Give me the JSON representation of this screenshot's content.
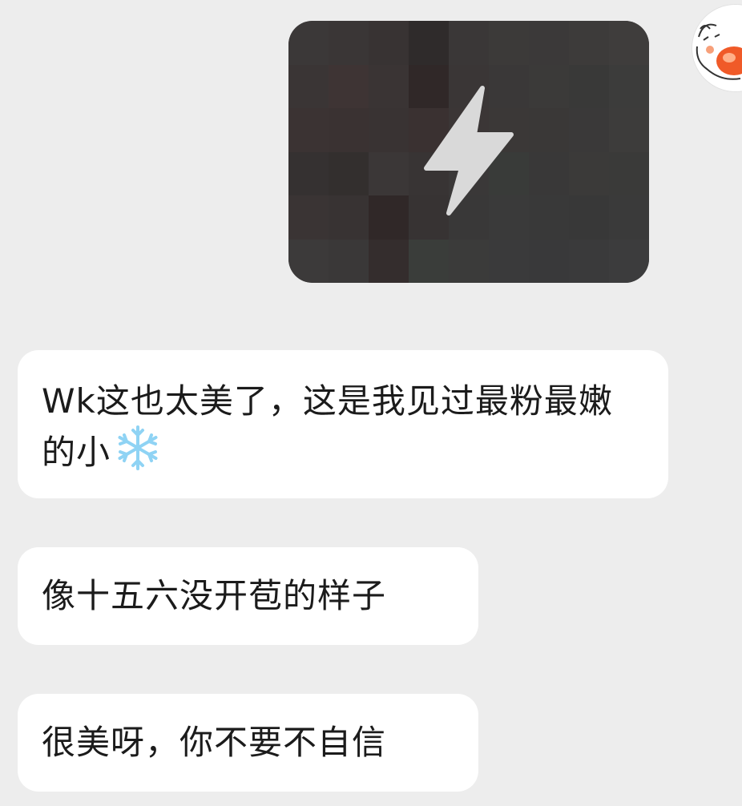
{
  "chat": {
    "messages": [
      {
        "side": "right",
        "type": "media",
        "thumbnail": "pixelated-dark-image",
        "overlay_icon": "flash-icon",
        "mosaic_colors": [
          "#3b3838",
          "#3a3636",
          "#383333",
          "#2f2b2b",
          "#3a3737",
          "#3c3a39",
          "#3b3939",
          "#3d3b3a",
          "#3f3d3c",
          "#3a3535",
          "#3e3434",
          "#3a3434",
          "#302828",
          "#3a3636",
          "#3a3838",
          "#3b3a39",
          "#393938",
          "#3c3c3b",
          "#3b3333",
          "#3a3232",
          "#393333",
          "#3a3131",
          "#3b3636",
          "#3b3837",
          "#3a3837",
          "#3a3939",
          "#3d3c3b",
          "#353131",
          "#332f2e",
          "#3b3737",
          "#383434",
          "#3a3838",
          "#393b39",
          "#393838",
          "#3b3a39",
          "#3a3a39",
          "#3a3434",
          "#383333",
          "#302828",
          "#373333",
          "#393838",
          "#3a3a3a",
          "#393939",
          "#383838",
          "#3a3a3a",
          "#3c3a3a",
          "#3a3838",
          "#342d2d",
          "#3a3d3a",
          "#3b3b3a",
          "#3a3a3b",
          "#39393a",
          "#3a3a3b",
          "#3c3c3d"
        ]
      },
      {
        "side": "left",
        "type": "text",
        "text": "Wk这也太美了，这是我见过最粉最嫩的小",
        "trailing_icon": "snowflake-icon"
      },
      {
        "side": "left",
        "type": "text",
        "text": "像十五六没开苞的样子"
      },
      {
        "side": "left",
        "type": "text",
        "text": "很美呀，你不要不自信"
      }
    ]
  },
  "colors": {
    "background": "#ededed",
    "bubble": "#ffffff",
    "text": "#1b1b1b",
    "media_overlay_icon": "#d9d9d9",
    "avatar_accent": "#f05a28"
  },
  "avatar": {
    "icon": "cartoon-cat-avatar-icon"
  }
}
